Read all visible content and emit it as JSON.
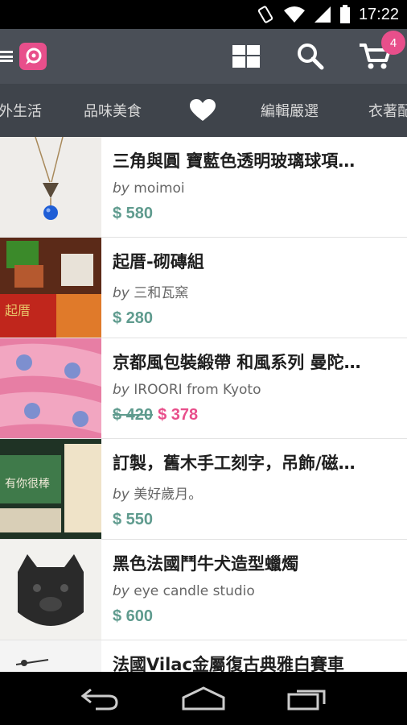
{
  "status_bar": {
    "time": "17:22"
  },
  "app_bar": {
    "cart_count": "4"
  },
  "tabs": [
    {
      "label": "外生活"
    },
    {
      "label": "品味美食"
    },
    {
      "label": "favorites",
      "icon": "heart-icon"
    },
    {
      "label": "編輯嚴選"
    },
    {
      "label": "衣著配"
    }
  ],
  "products": [
    {
      "title": "三角與圓 寶藍色透明玻璃球項…",
      "by": "by",
      "seller": "moimoi",
      "price": "$ 580",
      "old_price": "",
      "sale_price": ""
    },
    {
      "title": "起厝-砌磚組",
      "by": "by",
      "seller": "三和瓦窯",
      "price": "$ 280",
      "old_price": "",
      "sale_price": ""
    },
    {
      "title": "京都風包裝緞帶 和風系列 曼陀…",
      "by": "by",
      "seller": "IROORI from Kyoto",
      "price": "",
      "old_price": "$ 420",
      "sale_price": "$ 378"
    },
    {
      "title": "訂製，舊木手工刻字，吊飾/磁…",
      "by": "by",
      "seller": "美好歲月。",
      "price": "$ 550",
      "old_price": "",
      "sale_price": ""
    },
    {
      "title": "黑色法國鬥牛犬造型蠟燭",
      "by": "by",
      "seller": "eye candle studio",
      "price": "$ 600",
      "old_price": "",
      "sale_price": ""
    },
    {
      "title": "法國Vilac金屬復古典雅白賽車",
      "by": "",
      "seller": "",
      "price": "",
      "old_price": "",
      "sale_price": ""
    }
  ],
  "colors": {
    "accent": "#e84f8b",
    "price": "#5f9b8e",
    "app_bar": "#4a4f57",
    "tabs": "#3f444b"
  }
}
